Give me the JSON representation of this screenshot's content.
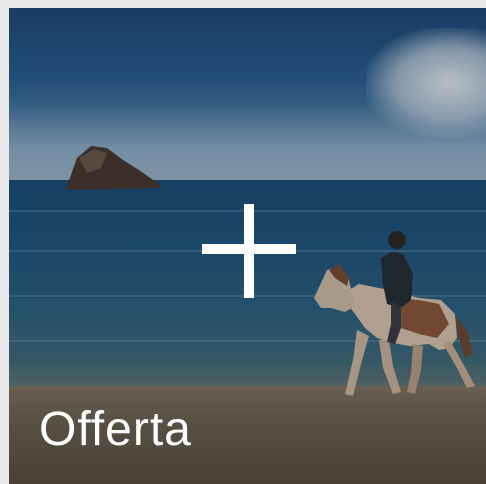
{
  "card": {
    "label": "Offerta",
    "icon": "plus-icon"
  }
}
